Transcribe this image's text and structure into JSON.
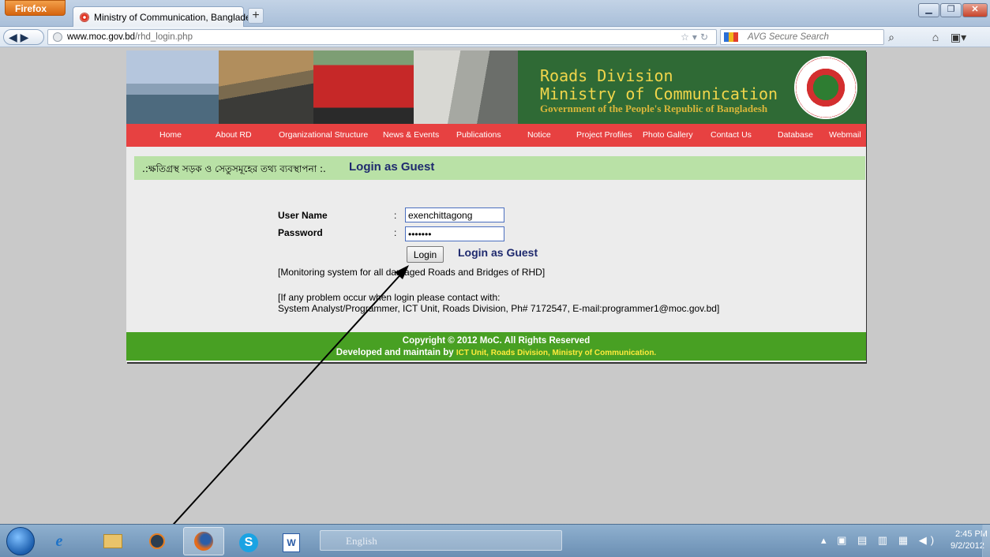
{
  "browser": {
    "menu_button": "Firefox",
    "tab_title": "Ministry of Communication, Bangladesh",
    "new_tab": "+",
    "url_host": "www.moc.gov.bd",
    "url_path": "/rhd_login.php",
    "search_placeholder": "AVG Secure Search"
  },
  "banner": {
    "line1": "Roads Division",
    "line2": "Ministry of Communication",
    "line3": "Government of the People's Republic of Bangladesh"
  },
  "menu": {
    "items": [
      "Home",
      "About RD",
      "Organizational Structure",
      "News & Events",
      "Publications",
      "Notice",
      "Project Profiles",
      "Photo Gallery",
      "Contact Us",
      "Database",
      "Webmail"
    ]
  },
  "page": {
    "bn_title": ".:ক্ষতিগ্রস্থ সড়ক ও সেতুসমূহের তথ্য ব্যবস্থাপনা :.",
    "heading": "Login as Guest"
  },
  "login": {
    "username_label": "User Name",
    "password_label": "Password",
    "colon": ":",
    "username_value": "exenchittagong",
    "password_value": "•••••••",
    "login_button": "Login",
    "guest_link": "Login as Guest",
    "monitoring_note": "[Monitoring system for all damaged Roads and Bridges of RHD]",
    "contact_line1": "[If any problem occur when login please contact with:",
    "contact_line2": "System Analyst/Programmer, ICT Unit, Roads Division, Ph# 7172547, E-mail:programmer1@moc.gov.bd]"
  },
  "footer": {
    "copyright": "Copyright © 2012 MoC. All Rights Reserved",
    "developed_by": "Developed and maintain by ",
    "developer": "ICT Unit, Roads Division, Ministry of Communication."
  },
  "taskbar": {
    "language": "English",
    "time": "2:45 PM",
    "date": "9/2/2012"
  },
  "colors": {
    "menu_red": "#e74141",
    "footer_green": "#48a023",
    "title_green": "#b9e1a6",
    "heading_blue": "#1f2a6e"
  }
}
